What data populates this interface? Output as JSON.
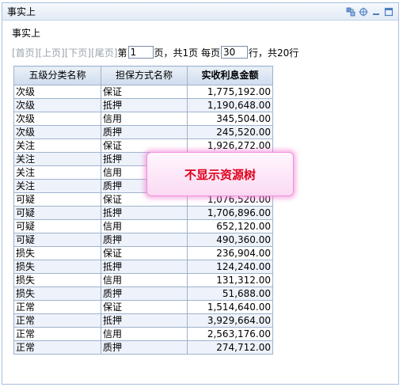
{
  "panel": {
    "title": "事实上",
    "tools": [
      "export-icon",
      "crosshair-icon",
      "minimize-icon",
      "maximize-icon"
    ]
  },
  "report": {
    "subtitle": "事实上",
    "pager": {
      "first": "[首页]",
      "prev": "[上页]",
      "next": "[下页]",
      "last": "[尾页]",
      "page_prefix": "第",
      "page_value": "1",
      "page_suffix": "页，共1页 每页",
      "size_value": "30",
      "size_suffix": "行，共20行"
    },
    "columns": [
      "五级分类名称",
      "担保方式名称",
      "实收利息金额"
    ],
    "rows": [
      [
        "次级",
        "保证",
        "1,775,192.00"
      ],
      [
        "次级",
        "抵押",
        "1,190,648.00"
      ],
      [
        "次级",
        "信用",
        "345,504.00"
      ],
      [
        "次级",
        "质押",
        "245,520.00"
      ],
      [
        "关注",
        "保证",
        "1,926,272.00"
      ],
      [
        "关注",
        "抵押",
        ""
      ],
      [
        "关注",
        "信用",
        ""
      ],
      [
        "关注",
        "质押",
        ""
      ],
      [
        "可疑",
        "保证",
        "1,076,520.00"
      ],
      [
        "可疑",
        "抵押",
        "1,706,896.00"
      ],
      [
        "可疑",
        "信用",
        "652,120.00"
      ],
      [
        "可疑",
        "质押",
        "490,360.00"
      ],
      [
        "损失",
        "保证",
        "236,904.00"
      ],
      [
        "损失",
        "抵押",
        "124,240.00"
      ],
      [
        "损失",
        "信用",
        "131,312.00"
      ],
      [
        "损失",
        "质押",
        "51,688.00"
      ],
      [
        "正常",
        "保证",
        "1,514,640.00"
      ],
      [
        "正常",
        "抵押",
        "3,929,664.00"
      ],
      [
        "正常",
        "信用",
        "2,563,176.00"
      ],
      [
        "正常",
        "质押",
        "274,712.00"
      ]
    ]
  },
  "tooltip": {
    "text": "不显示资源树"
  }
}
